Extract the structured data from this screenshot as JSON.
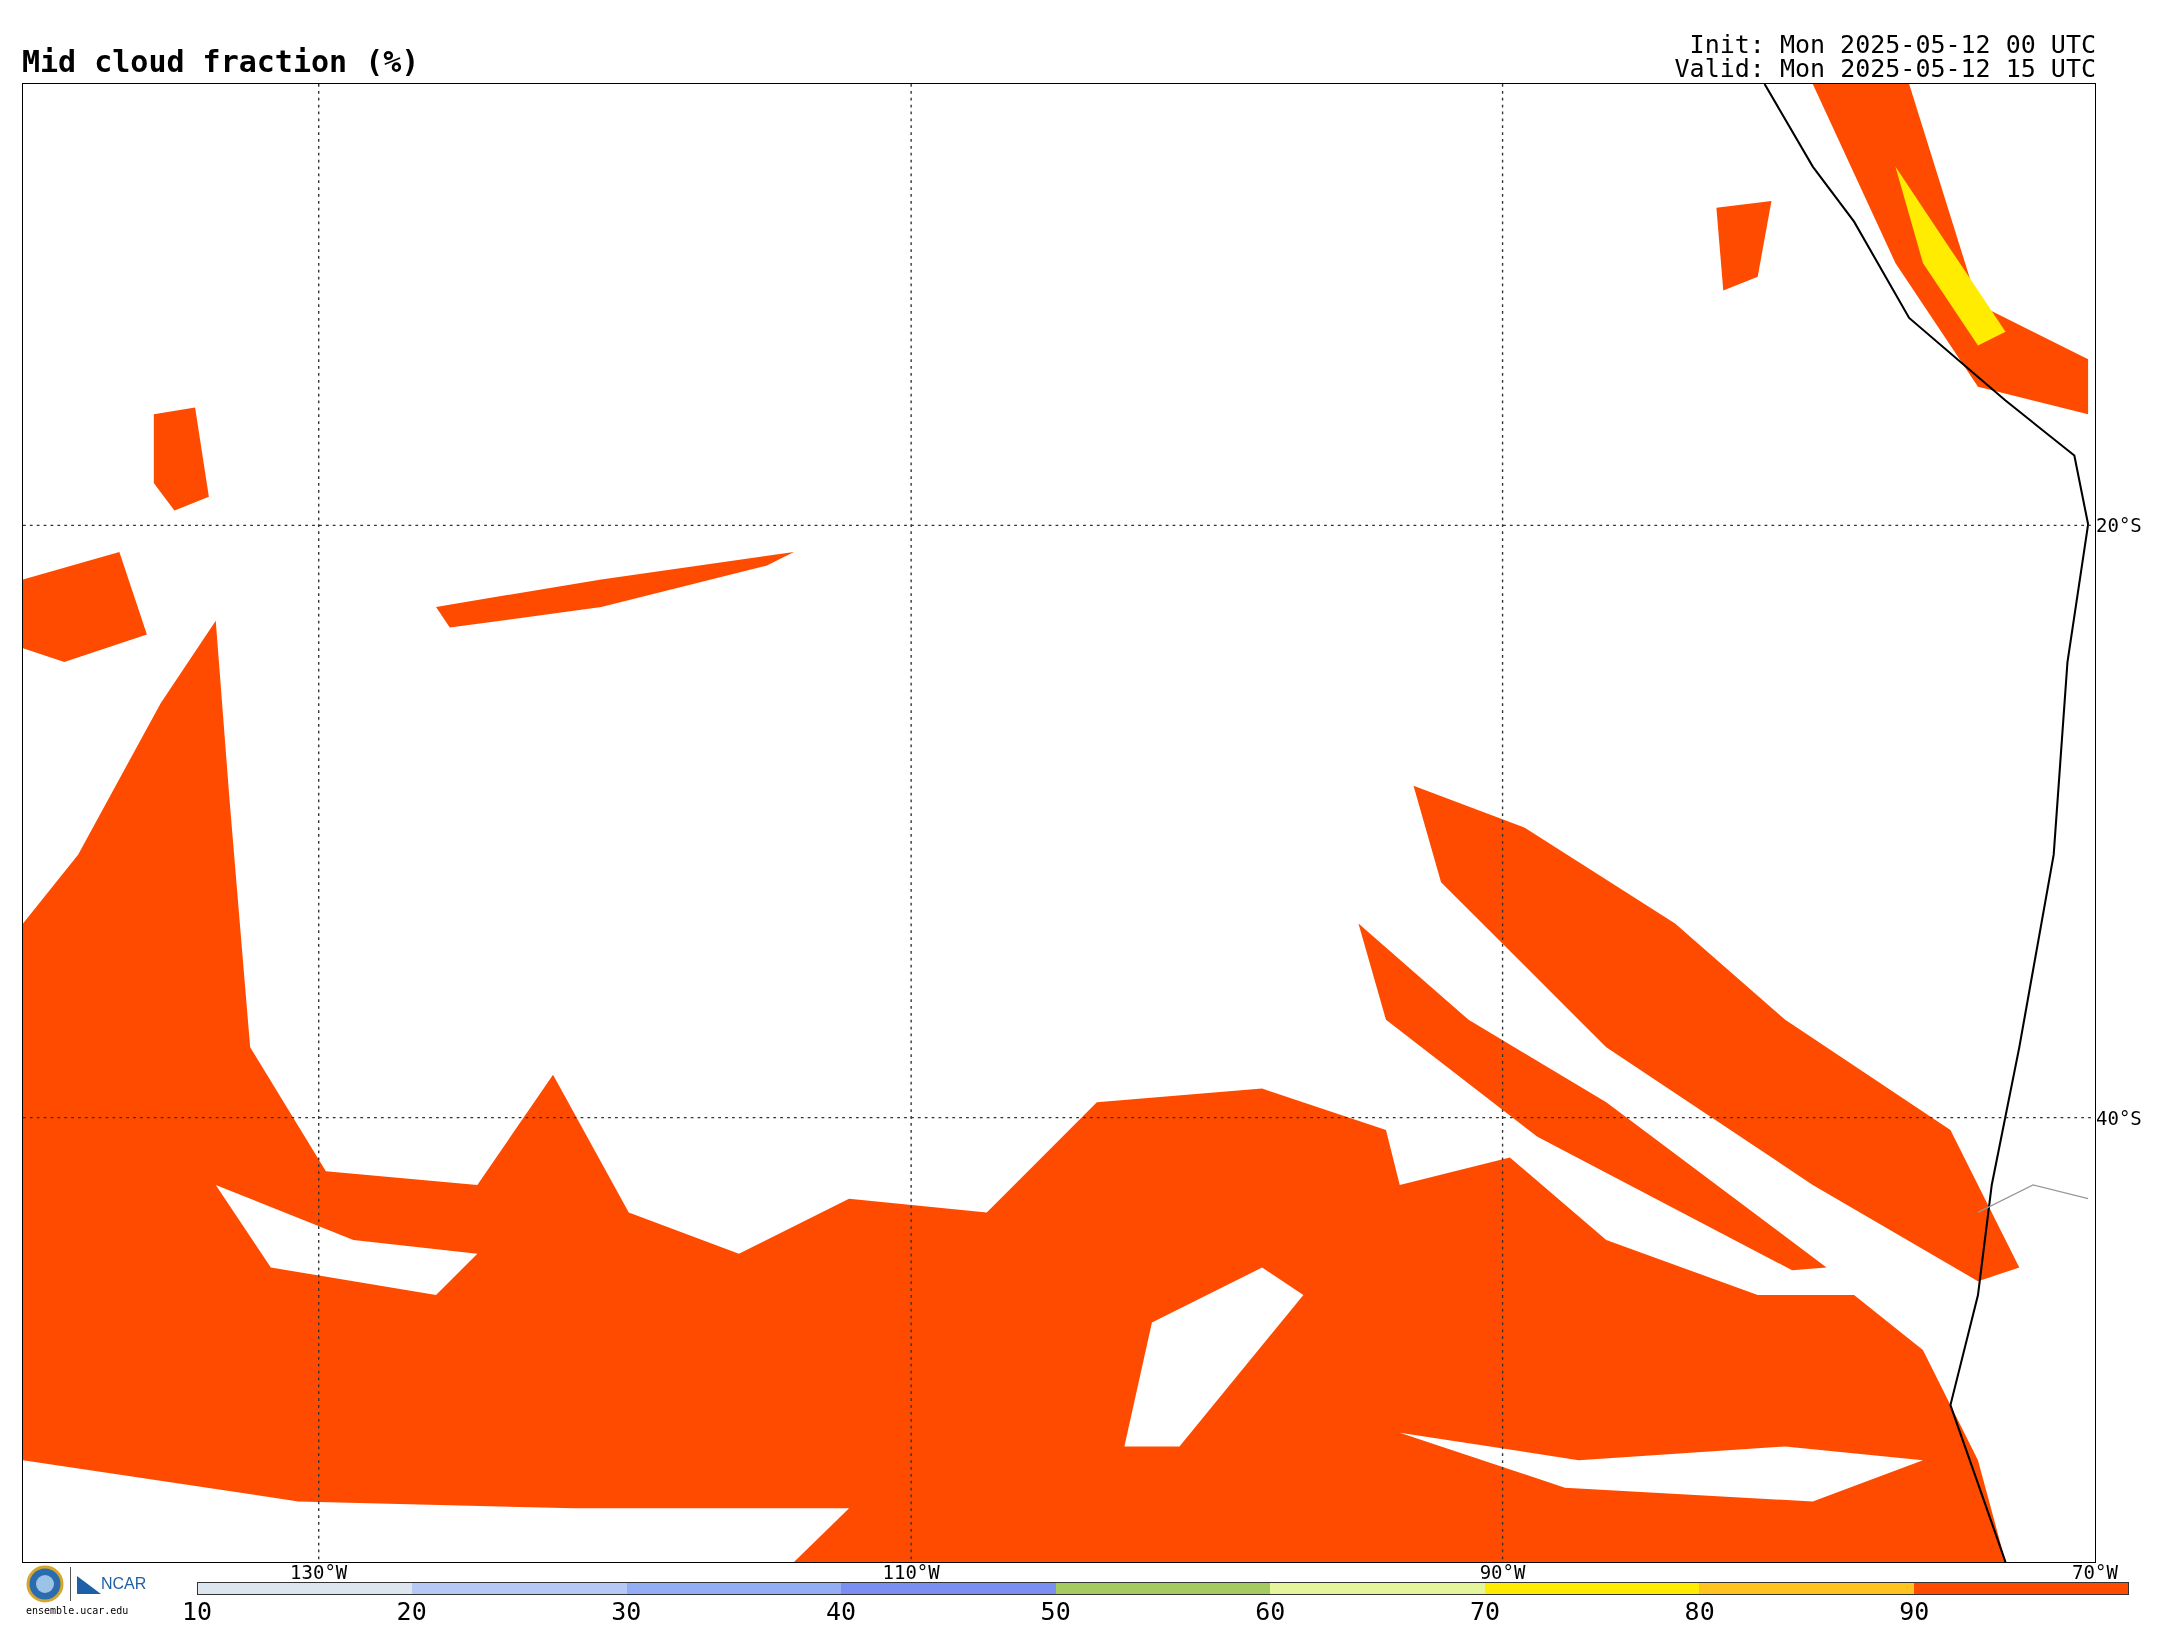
{
  "title": "Mid cloud fraction (%)",
  "init": "Init: Mon 2025-05-12 00 UTC",
  "valid": "Valid: Mon 2025-05-12 15 UTC",
  "map": {
    "lon_labels": [
      "130°W",
      "110°W",
      "90°W",
      "70°W"
    ],
    "lat_labels": [
      "20°S",
      "40°S"
    ]
  },
  "logo": {
    "name": "NCAR",
    "url": "ensemble.ucar.edu"
  },
  "colorbar": {
    "segments": [
      {
        "color": "#dde6ee"
      },
      {
        "color": "#b6c8f4"
      },
      {
        "color": "#94aef6"
      },
      {
        "color": "#7b8ef2"
      },
      {
        "color": "#a5cb60"
      },
      {
        "color": "#e4f59c"
      },
      {
        "color": "#ffec00"
      },
      {
        "color": "#ffc41e"
      },
      {
        "color": "#ff4b00"
      }
    ],
    "ticks": [
      "10",
      "20",
      "30",
      "40",
      "50",
      "60",
      "70",
      "80",
      "90"
    ]
  }
}
